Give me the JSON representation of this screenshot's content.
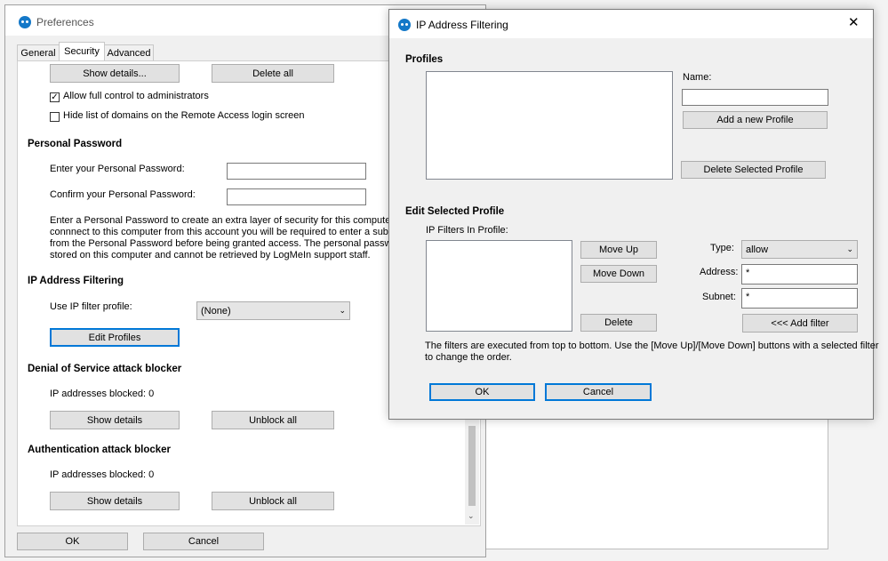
{
  "background_window": {},
  "preferences": {
    "title": "Preferences",
    "tabs": [
      "General",
      "Security",
      "Advanced"
    ],
    "show_details_top": "Show details...",
    "delete_all": "Delete all",
    "allow_full_control": "Allow full control to administrators",
    "allow_full_control_checked": true,
    "hide_domains": "Hide list of domains on the Remote Access login screen",
    "hide_domains_checked": false,
    "personal_password": {
      "heading": "Personal Password",
      "enter_label": "Enter your Personal Password:",
      "confirm_label": "Confirm your Personal Password:",
      "desc_lines": [
        "Enter a Personal Password to create an extra layer of security for this computer. Whe",
        "connnect to this computer from this account you will be required to enter a subset of c",
        "from the Personal Password before being granted access. The personal password is s",
        "stored on this computer and cannot be retrieved by LogMeIn support staff."
      ]
    },
    "ip_filtering": {
      "heading": "IP Address Filtering",
      "use_label": "Use IP filter profile:",
      "profile_value": "(None)",
      "edit_profiles": "Edit Profiles"
    },
    "dos": {
      "heading": "Denial of Service attack blocker",
      "blocked": "IP addresses blocked: 0",
      "show_details": "Show details",
      "unblock_all": "Unblock all"
    },
    "auth": {
      "heading": "Authentication attack blocker",
      "blocked": "IP addresses blocked: 0",
      "show_details": "Show details",
      "unblock_all": "Unblock all"
    },
    "ok": "OK",
    "cancel": "Cancel"
  },
  "ip_dialog": {
    "title": "IP Address Filtering",
    "close": "✕",
    "profiles_heading": "Profiles",
    "name_label": "Name:",
    "name_value": "",
    "add_profile": "Add a new Profile",
    "delete_profile": "Delete Selected Profile",
    "edit_heading": "Edit Selected Profile",
    "filters_label": "IP Filters In Profile:",
    "move_up": "Move Up",
    "move_down": "Move Down",
    "delete": "Delete",
    "type_label": "Type:",
    "type_value": "allow",
    "address_label": "Address:",
    "address_value": "*",
    "subnet_label": "Subnet:",
    "subnet_value": "*",
    "add_filter": "<<< Add filter",
    "note_lines": [
      "The filters are executed from top to bottom. Use the [Move Up]/[Move Down] buttons with a selected filter",
      "to change the order."
    ],
    "ok": "OK",
    "cancel": "Cancel"
  }
}
